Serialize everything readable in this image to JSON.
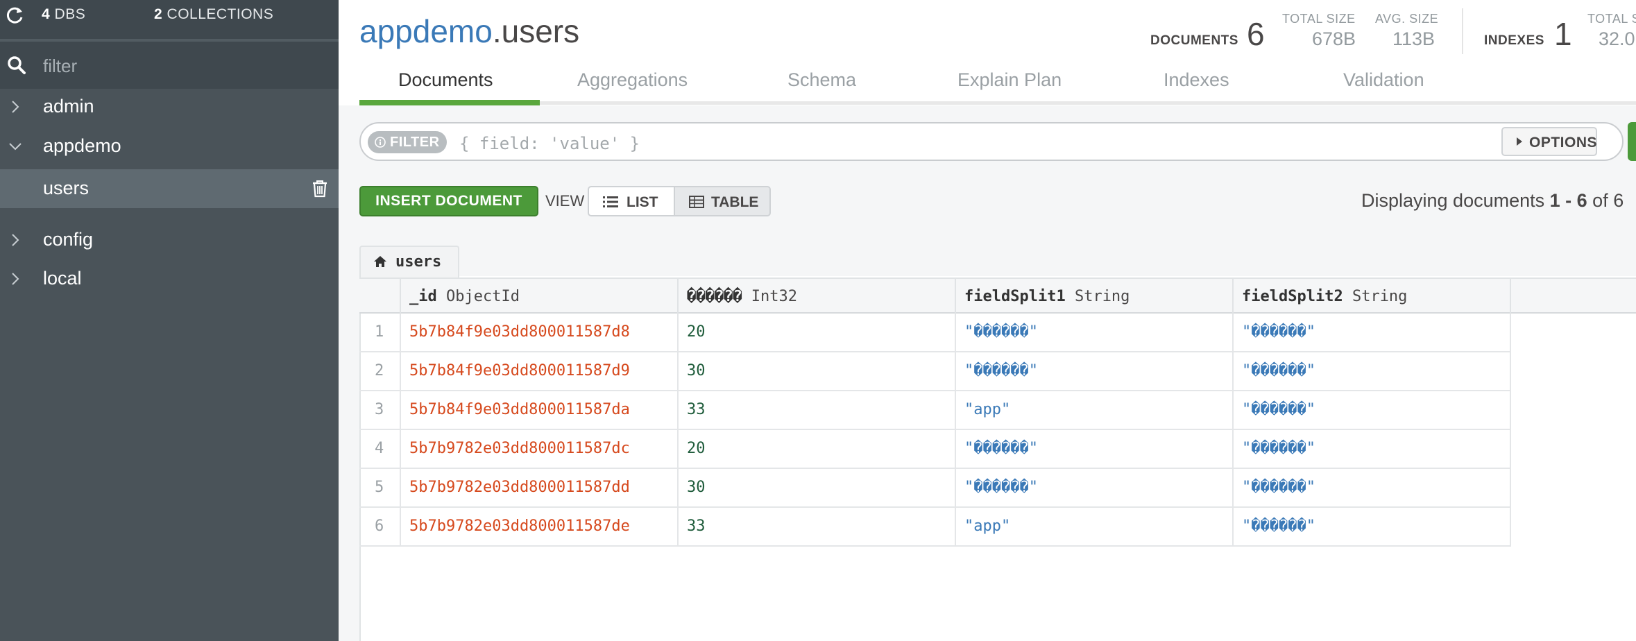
{
  "sidebar": {
    "dbs_count": "4",
    "dbs_label": "DBS",
    "collections_count": "2",
    "collections_label": "COLLECTIONS",
    "filter_placeholder": "filter",
    "databases": [
      "admin",
      "appdemo",
      "config",
      "local"
    ],
    "active_collection": "users"
  },
  "header": {
    "db": "appdemo",
    "collection": ".users",
    "documents_label": "DOCUMENTS",
    "documents_value": "6",
    "total_size_label": "TOTAL SIZE",
    "total_size_value": "678B",
    "avg_size_label": "AVG. SIZE",
    "avg_size_value": "113B",
    "indexes_label": "INDEXES",
    "indexes_value": "1",
    "total_index_size_label": "TOTAL S",
    "total_index_size_value": "32.0"
  },
  "tabs": [
    "Documents",
    "Aggregations",
    "Schema",
    "Explain Plan",
    "Indexes",
    "Validation"
  ],
  "query": {
    "filter_label": "FILTER",
    "placeholder": "{ field: 'value' }",
    "options_label": "OPTIONS"
  },
  "toolbar": {
    "insert_label": "INSERT DOCUMENT",
    "view_label": "VIEW",
    "list_label": "LIST",
    "table_label": "TABLE",
    "display_prefix": "Displaying documents ",
    "display_range": "1 - 6",
    "display_of": " of 6"
  },
  "grid": {
    "tab_label": "users",
    "columns": [
      {
        "name": "_id",
        "type": "ObjectId"
      },
      {
        "name": "������",
        "type": "Int32"
      },
      {
        "name": "fieldSplit1",
        "type": "String"
      },
      {
        "name": "fieldSplit2",
        "type": "String"
      }
    ],
    "rows": [
      {
        "n": "1",
        "id": "5b7b84f9e03dd800011587d8",
        "num": "20",
        "f1": "\"������\"",
        "f2": "\"������\""
      },
      {
        "n": "2",
        "id": "5b7b84f9e03dd800011587d9",
        "num": "30",
        "f1": "\"������\"",
        "f2": "\"������\""
      },
      {
        "n": "3",
        "id": "5b7b84f9e03dd800011587da",
        "num": "33",
        "f1": "\"app\"",
        "f2": "\"������\""
      },
      {
        "n": "4",
        "id": "5b7b9782e03dd800011587dc",
        "num": "20",
        "f1": "\"������\"",
        "f2": "\"������\""
      },
      {
        "n": "5",
        "id": "5b7b9782e03dd800011587dd",
        "num": "30",
        "f1": "\"������\"",
        "f2": "\"������\""
      },
      {
        "n": "6",
        "id": "5b7b9782e03dd800011587de",
        "num": "33",
        "f1": "\"app\"",
        "f2": "\"������\""
      }
    ]
  },
  "colors": {
    "sidebar_bg": "#4a5359",
    "accent_green": "#4c9a3a",
    "db_blue": "#3a79b7",
    "objectid_orange": "#d6491d",
    "int_green": "#1f5c3b"
  }
}
